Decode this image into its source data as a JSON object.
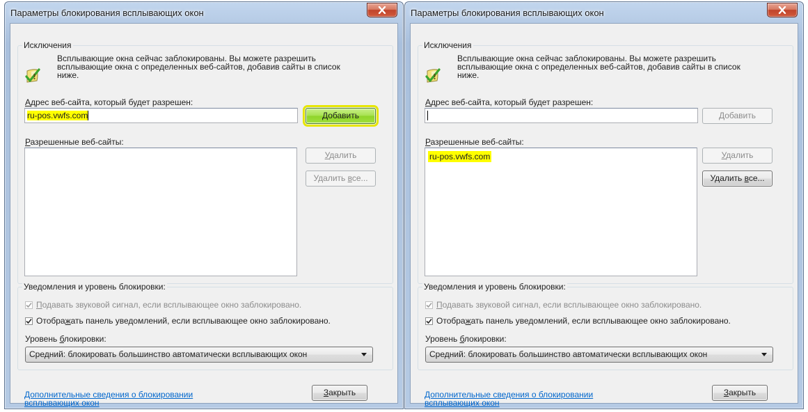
{
  "dialogs": [
    {
      "title": "Параметры блокирования всплывающих окон",
      "exceptions_label": "Исключения",
      "info_text": "Всплывающие окна сейчас заблокированы. Вы можете разрешить всплывающие окна с определенных веб-сайтов, добавив сайты в список ниже.",
      "address_label": {
        "pre": "",
        "accel": "А",
        "post": "дрес веб-сайта, который будет разрешен:"
      },
      "address_value": "ru-pos.vwfs.com",
      "add_button": {
        "pre": "",
        "accel": "Д",
        "post": "обавить",
        "state": "active"
      },
      "allowed_label": {
        "pre": "",
        "accel": "Р",
        "post": "азрешенные веб-сайты:"
      },
      "allowed_sites": [],
      "remove_button": {
        "pre": "",
        "accel": "У",
        "post": "далить",
        "state": "disabled"
      },
      "remove_all_button": {
        "pre": "Удалить ",
        "accel": "в",
        "post": "се...",
        "state": "disabled"
      },
      "notifications_label": "Уведомления и уровень блокировки:",
      "sound_checkbox": {
        "pre": "",
        "accel": "П",
        "post": "одавать звуковой сигнал, если всплывающее окно заблокировано.",
        "checked": true,
        "disabled": true
      },
      "bar_checkbox": {
        "pre": "Отобра",
        "accel": "ж",
        "post": "ать панель уведомлений, если всплывающее окно заблокировано.",
        "checked": true,
        "disabled": false
      },
      "level_label": {
        "pre": "Уровень ",
        "accel": "б",
        "post": "локировки:"
      },
      "level_value": "Средний: блокировать большинство автоматически всплывающих окон",
      "more_link": "Дополнительные сведения о блокировании всплывающих окон",
      "close_button": {
        "pre": "",
        "accel": "З",
        "post": "акрыть"
      }
    },
    {
      "title": "Параметры блокирования всплывающих окон",
      "exceptions_label": "Исключения",
      "info_text": "Всплывающие окна сейчас заблокированы. Вы можете разрешить всплывающие окна с определенных веб-сайтов, добавив сайты в список ниже.",
      "address_label": {
        "pre": "",
        "accel": "А",
        "post": "дрес веб-сайта, который будет разрешен:"
      },
      "address_value": "",
      "add_button": {
        "pre": "",
        "accel": "Д",
        "post": "обавить",
        "state": "disabled"
      },
      "allowed_label": {
        "pre": "",
        "accel": "Р",
        "post": "азрешенные веб-сайты:"
      },
      "allowed_sites": [
        "ru-pos.vwfs.com"
      ],
      "remove_button": {
        "pre": "",
        "accel": "У",
        "post": "далить",
        "state": "disabled"
      },
      "remove_all_button": {
        "pre": "Удалить ",
        "accel": "в",
        "post": "се...",
        "state": "enabled"
      },
      "notifications_label": "Уведомления и уровень блокировки:",
      "sound_checkbox": {
        "pre": "",
        "accel": "П",
        "post": "одавать звуковой сигнал, если всплывающее окно заблокировано.",
        "checked": true,
        "disabled": true
      },
      "bar_checkbox": {
        "pre": "Отобра",
        "accel": "ж",
        "post": "ать панель уведомлений, если всплывающее окно заблокировано.",
        "checked": true,
        "disabled": false
      },
      "level_label": {
        "pre": "Уровень ",
        "accel": "б",
        "post": "локировки:"
      },
      "level_value": "Средний: блокировать большинство автоматически всплывающих окон",
      "more_link": "Дополнительные сведения о блокировании всплывающих окон",
      "close_button": {
        "pre": "",
        "accel": "З",
        "post": "акрыть"
      }
    }
  ],
  "colors": {
    "highlight": "#ffff00",
    "link": "#0066cc",
    "add_button_active": "#a6e24e",
    "close_button": "#c0442b"
  },
  "icons": [
    "close-x-icon",
    "shield-check-icon",
    "checkbox-check-icon",
    "dropdown-arrow-icon"
  ]
}
